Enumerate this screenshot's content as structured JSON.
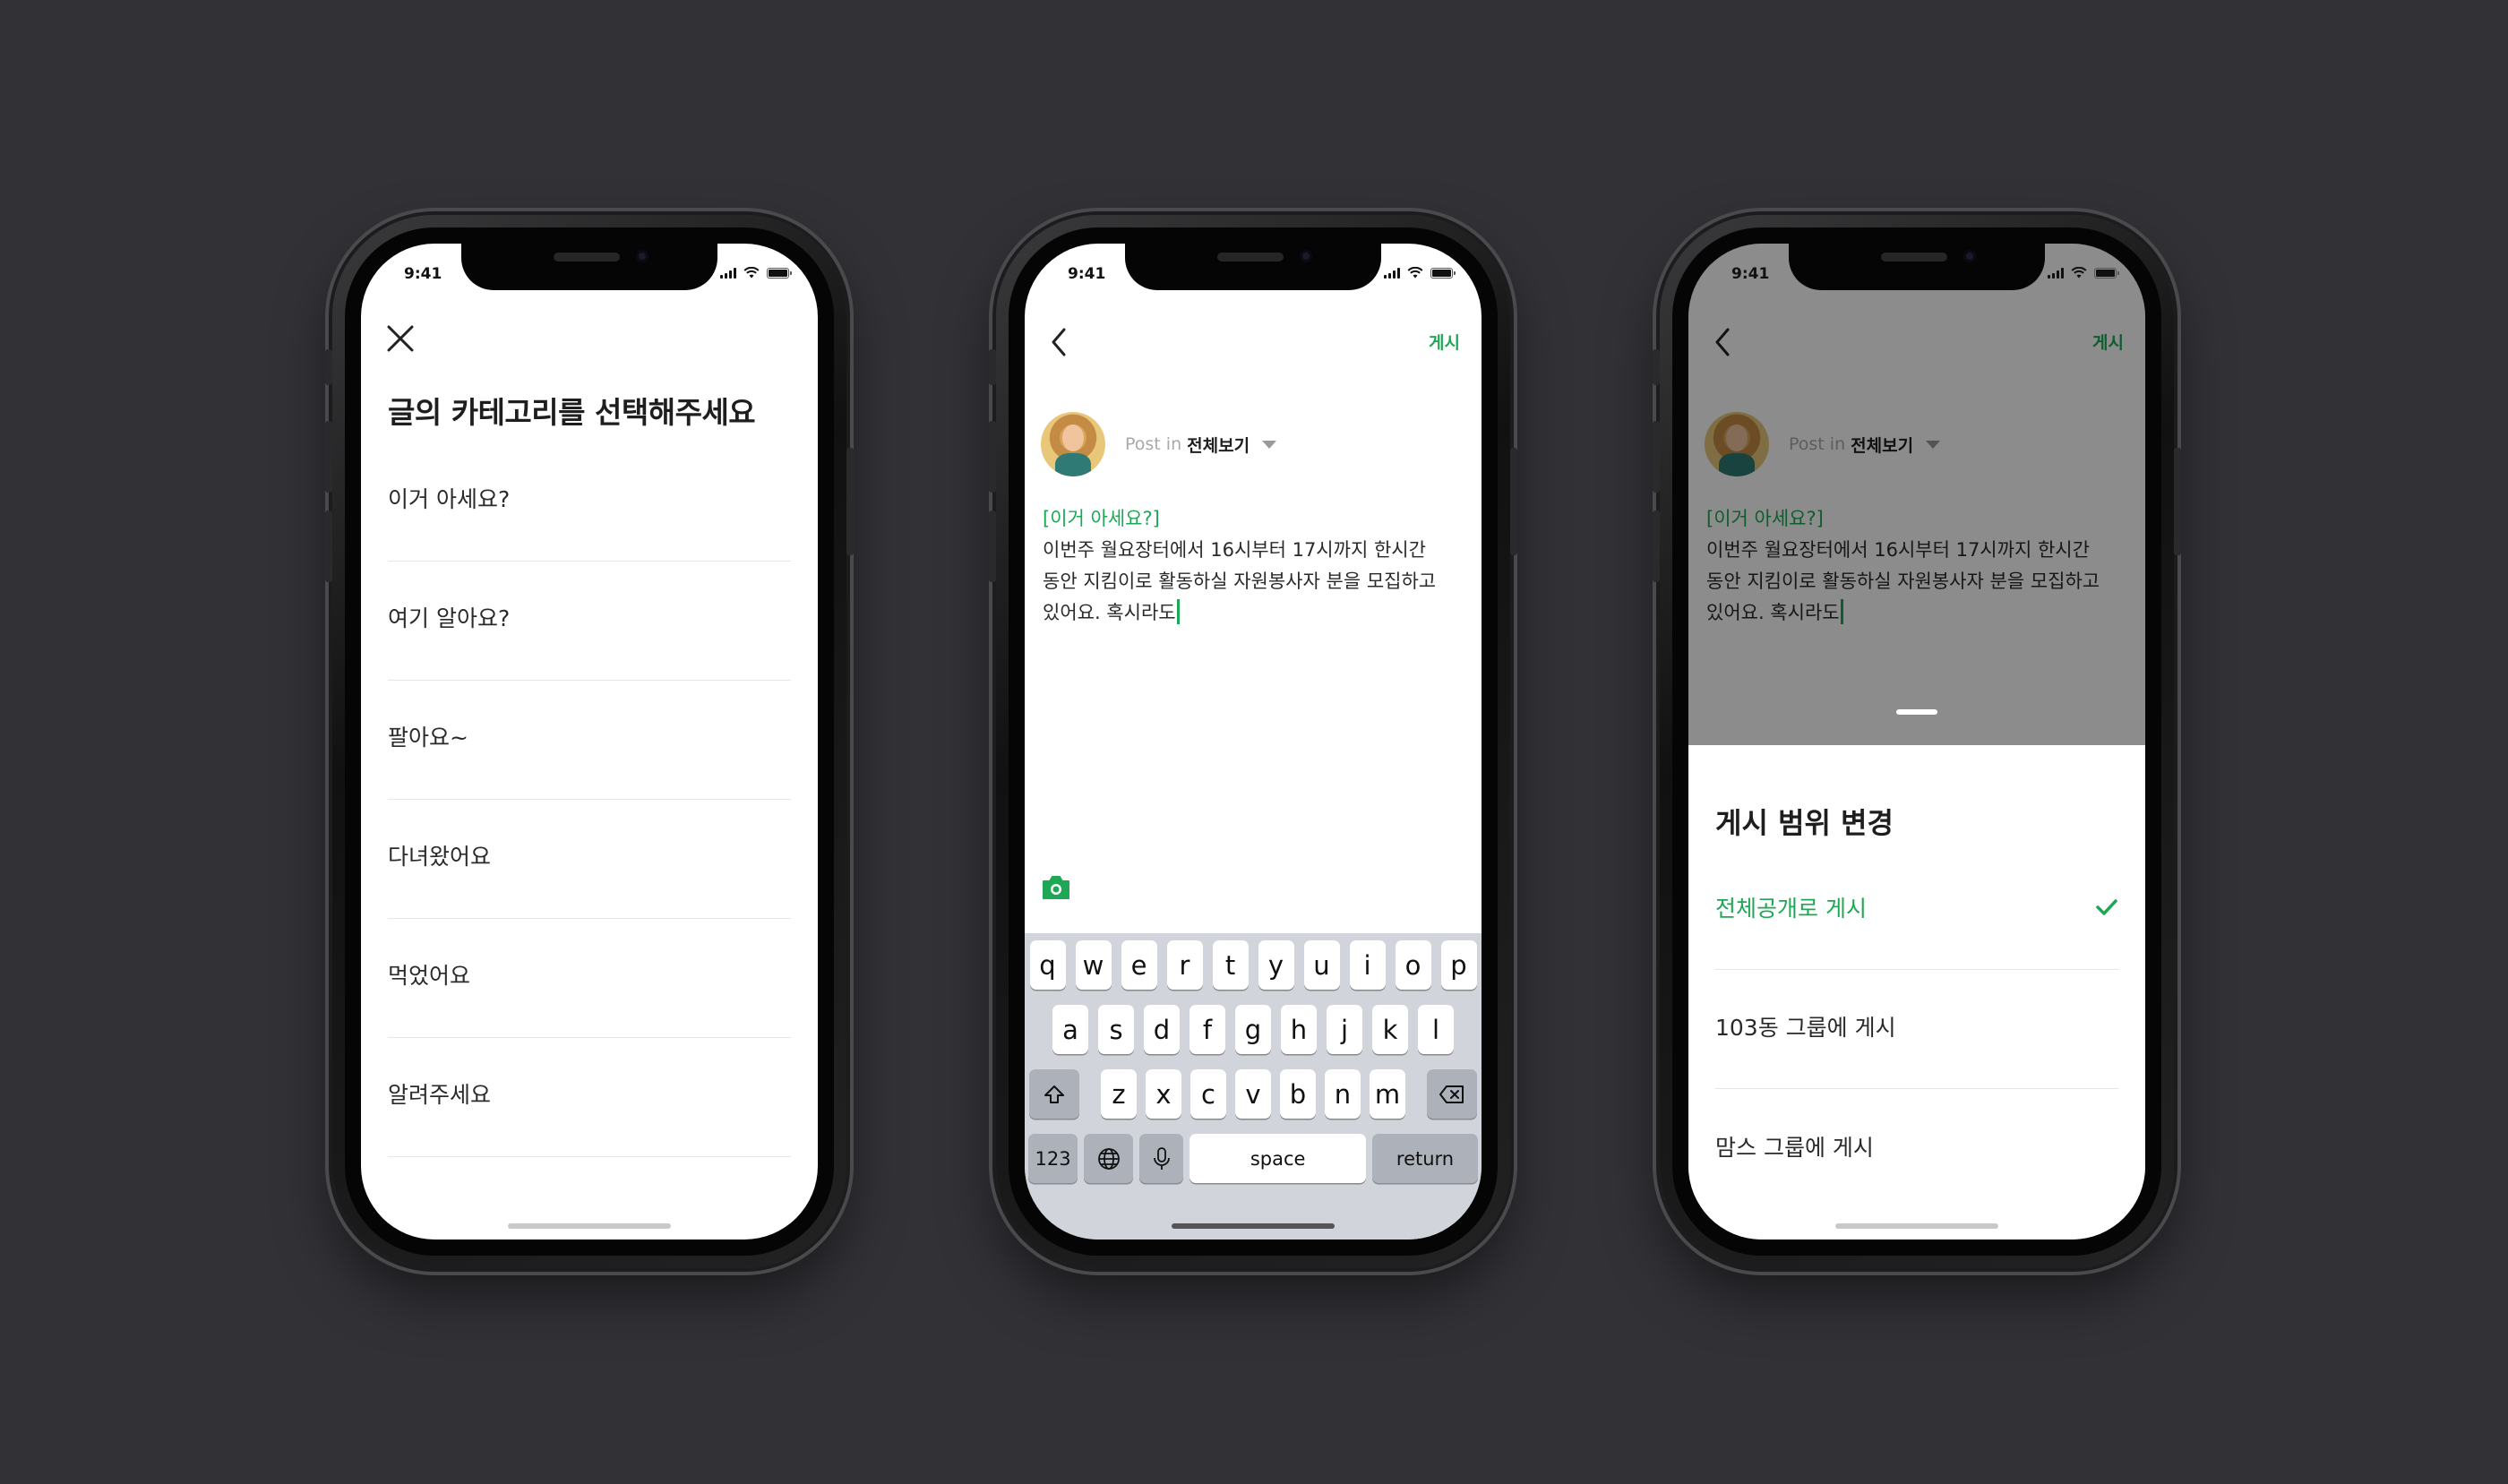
{
  "colors": {
    "accent": "#1ea855",
    "background": "#323136"
  },
  "status_bar": {
    "time": "9:41"
  },
  "screen1": {
    "title": "글의 카테고리를 선택해주세요",
    "categories": [
      "이거 아세요?",
      "여기 알아요?",
      "팔아요~",
      "다녀왔어요",
      "먹었어요",
      "알려주세요"
    ]
  },
  "compose": {
    "post_button": "게시",
    "post_in_label": "Post in",
    "board_name": "전체보기",
    "tag": "[이거 아세요?]",
    "lines": [
      "이번주 월요장터에서 16시부터 17시까지 한시간",
      "동안 지킴이로 활동하실 자원봉사자 분을 모집하고",
      "있어요. 혹시라도"
    ]
  },
  "keyboard": {
    "row1": [
      "q",
      "w",
      "e",
      "r",
      "t",
      "y",
      "u",
      "i",
      "o",
      "p"
    ],
    "row2": [
      "a",
      "s",
      "d",
      "f",
      "g",
      "h",
      "j",
      "k",
      "l"
    ],
    "row3": [
      "z",
      "x",
      "c",
      "v",
      "b",
      "n",
      "m"
    ],
    "numbers_key": "123",
    "space_key": "space",
    "return_key": "return"
  },
  "sheet": {
    "title": "게시 범위 변경",
    "options": [
      "전체공개로 게시",
      "103동 그룹에 게시",
      "맘스 그룹에 게시"
    ],
    "selected_index": 0
  }
}
